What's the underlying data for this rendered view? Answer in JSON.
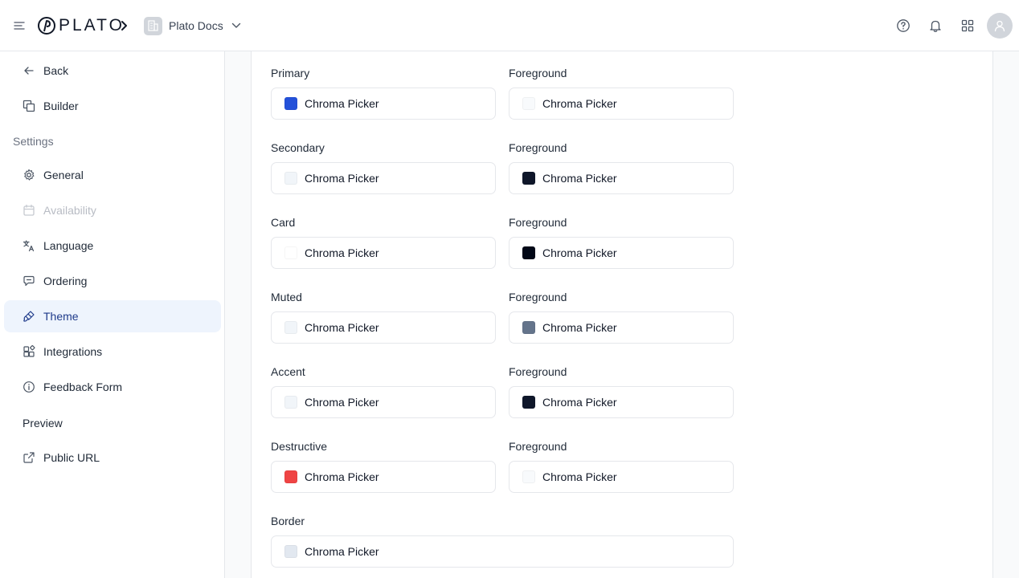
{
  "header": {
    "logo_text": "PLATO",
    "workspace_name": "Plato Docs"
  },
  "sidebar": {
    "back": "Back",
    "builder": "Builder",
    "settings_heading": "Settings",
    "settings_items": [
      {
        "label": "General"
      },
      {
        "label": "Availability"
      },
      {
        "label": "Language"
      },
      {
        "label": "Ordering"
      },
      {
        "label": "Theme"
      },
      {
        "label": "Integrations"
      },
      {
        "label": "Feedback Form"
      }
    ],
    "preview_heading": "Preview",
    "public_url": "Public URL"
  },
  "theme": {
    "rows": [
      {
        "label": "Primary",
        "picker": "Chroma Picker",
        "color": "#2451d9",
        "fg_label": "Foreground",
        "fg_picker": "Chroma Picker",
        "fg_color": "#f8fafc"
      },
      {
        "label": "Secondary",
        "picker": "Chroma Picker",
        "color": "#f1f5f9",
        "fg_label": "Foreground",
        "fg_picker": "Chroma Picker",
        "fg_color": "#0f172a"
      },
      {
        "label": "Card",
        "picker": "Chroma Picker",
        "color": "#ffffff",
        "fg_label": "Foreground",
        "fg_picker": "Chroma Picker",
        "fg_color": "#020817"
      },
      {
        "label": "Muted",
        "picker": "Chroma Picker",
        "color": "#f1f5f9",
        "fg_label": "Foreground",
        "fg_picker": "Chroma Picker",
        "fg_color": "#64748b"
      },
      {
        "label": "Accent",
        "picker": "Chroma Picker",
        "color": "#f1f5f9",
        "fg_label": "Foreground",
        "fg_picker": "Chroma Picker",
        "fg_color": "#0f172a"
      },
      {
        "label": "Destructive",
        "picker": "Chroma Picker",
        "color": "#ef4444",
        "fg_label": "Foreground",
        "fg_picker": "Chroma Picker",
        "fg_color": "#f8fafc"
      }
    ],
    "border": {
      "label": "Border",
      "picker": "Chroma Picker",
      "color": "#e2e8f0"
    }
  },
  "colors": {
    "active_nav_bg": "#eef4fd",
    "avatar_bg": "#d1d5db"
  },
  "icons": [
    "menu-icon",
    "chevron-right-icon",
    "building-icon",
    "chevron-down-icon",
    "help-circle-icon",
    "bell-icon",
    "grid-icon",
    "user-icon",
    "arrow-left-icon",
    "builder-icon",
    "gear-icon",
    "calendar-icon",
    "language-icon",
    "ordering-icon",
    "paint-brush-icon",
    "integrations-icon",
    "info-icon",
    "external-link-icon"
  ]
}
